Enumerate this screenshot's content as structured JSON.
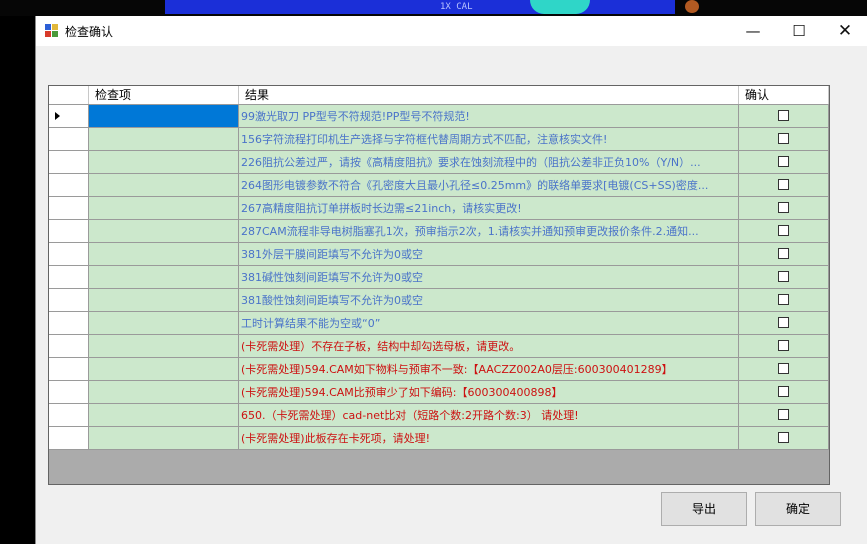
{
  "window": {
    "title": "检查确认"
  },
  "background_text": "1X CAL",
  "grid": {
    "headers": {
      "item": "检查项",
      "result": "结果",
      "confirm": "确认"
    },
    "rows": [
      {
        "result": "99激光取刀 PP型号不符规范!PP型号不符规范!",
        "color": "#4a73c9",
        "selected": true
      },
      {
        "result": "156字符流程打印机生产选择与字符框代替周期方式不匹配，注意核实文件!",
        "color": "#4a73c9"
      },
      {
        "result": "226阻抗公差过严，请按《高精度阻抗》要求在蚀刻流程中的（阻抗公差非正负10%（Y/N）...",
        "color": "#4a73c9"
      },
      {
        "result": "264图形电镀参数不符合《孔密度大且最小孔径≤0.25mm》的联络单要求[电镀(CS+SS)密度...",
        "color": "#4a73c9"
      },
      {
        "result": "267高精度阻抗订单拼板时长边需≤21inch，请核实更改!",
        "color": "#4a73c9"
      },
      {
        "result": "287CAM流程非导电树脂塞孔1次，预审指示2次，1.请核实并通知预审更改报价条件.2.通知...",
        "color": "#4a73c9"
      },
      {
        "result": "381外层干膜间距填写不允许为0或空",
        "color": "#4a73c9"
      },
      {
        "result": "381碱性蚀刻间距填写不允许为0或空",
        "color": "#4a73c9"
      },
      {
        "result": "381酸性蚀刻间距填写不允许为0或空",
        "color": "#4a73c9"
      },
      {
        "result": "工时计算结果不能为空或“0”",
        "color": "#4a73c9"
      },
      {
        "result": "(卡死需处理）不存在子板，结构中却勾选母板，请更改。",
        "color": "#cc1111"
      },
      {
        "result": "(卡死需处理)594.CAM如下物料与预审不一致:【AACZZ002A0层压:600300401289】",
        "color": "#cc1111"
      },
      {
        "result": "(卡死需处理)594.CAM比预审少了如下编码:【600300400898】",
        "color": "#cc1111"
      },
      {
        "result": "650.（卡死需处理）cad-net比对（短路个数:2开路个数:3） 请处理!",
        "color": "#cc1111"
      },
      {
        "result": "(卡死需处理)此板存在卡死项，请处理!",
        "color": "#cc1111"
      }
    ]
  },
  "buttons": {
    "export": "导出",
    "ok": "确定"
  },
  "colors": {
    "cell_bg": "#cce8cc",
    "selection": "#0078d7",
    "info_text": "#4a73c9",
    "error_text": "#cc1111"
  }
}
